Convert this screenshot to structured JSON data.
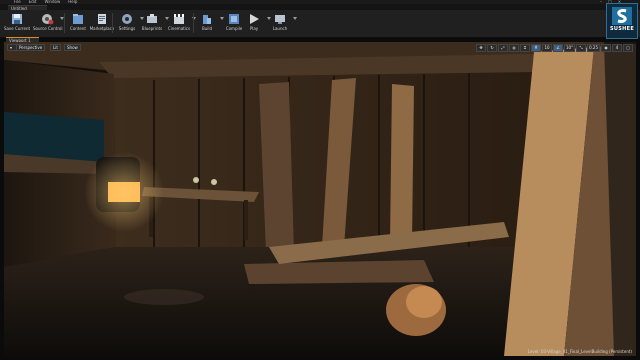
{
  "menu": {
    "items": [
      "File",
      "Edit",
      "Window",
      "Help"
    ]
  },
  "window": {
    "controls": [
      "–",
      "□",
      "×"
    ],
    "level_tab": "Untitled"
  },
  "toolbar": {
    "buttons": [
      {
        "label": "Save Current",
        "icon": "save-icon"
      },
      {
        "label": "Source Control",
        "icon": "source-control-icon"
      },
      {
        "label": "Content",
        "icon": "content-icon"
      },
      {
        "label": "Marketplace",
        "icon": "marketplace-icon"
      },
      {
        "label": "Settings",
        "icon": "settings-icon"
      },
      {
        "label": "Blueprints",
        "icon": "blueprints-icon"
      },
      {
        "label": "Cinematics",
        "icon": "cinematics-icon"
      },
      {
        "label": "Build",
        "icon": "build-icon"
      },
      {
        "label": "Compile",
        "icon": "compile-icon"
      },
      {
        "label": "Play",
        "icon": "play-icon"
      },
      {
        "label": "Launch",
        "icon": "launch-icon"
      }
    ]
  },
  "brand": {
    "name": "SUSHEE"
  },
  "viewport": {
    "tab_label": "Viewport 1",
    "view_mode": "Perspective",
    "lighting": "Lit",
    "show": "Show",
    "snap_controls": [
      "10",
      "10°",
      "0.25",
      "4"
    ],
    "level_info": "Level:  03-Village_01_Final_LevelBuilding (Persistent)"
  },
  "colors": {
    "accent": "#e08c1e",
    "toolbar_bg": "#202020",
    "brand_bg": "#0e2a3c"
  }
}
